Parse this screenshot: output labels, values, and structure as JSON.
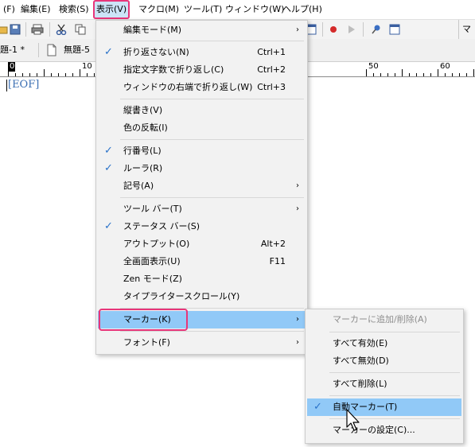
{
  "menubar": {
    "items": [
      {
        "label": "(F)"
      },
      {
        "label": "編集(E)"
      },
      {
        "label": "検索(S)"
      },
      {
        "label": "表示(V)"
      },
      {
        "label": "マクロ(M)"
      },
      {
        "label": "ツール(T)"
      },
      {
        "label": "ウィンドウ(W)"
      },
      {
        "label": "ヘルプ(H)"
      }
    ]
  },
  "toolbar": {
    "right_text": "マ",
    "icons": [
      "folder-icon",
      "save-icon",
      "print-icon",
      "cut-icon",
      "copy-icon",
      "window-icon",
      "record-icon",
      "play-icon",
      "pin-icon",
      "window-icon"
    ]
  },
  "tabs": [
    {
      "label": "題-1 *"
    },
    {
      "label": "無題-5"
    }
  ],
  "ruler": {
    "labels": [
      "0",
      "10",
      "50",
      "60"
    ]
  },
  "editor": {
    "eof": "[EOF]"
  },
  "view_menu": {
    "items": [
      {
        "label": "編集モード(M)",
        "shortcut": "",
        "arrow": "›",
        "check": ""
      },
      {
        "label": "折り返さない(N)",
        "shortcut": "Ctrl+1",
        "arrow": "",
        "check": "✓"
      },
      {
        "label": "指定文字数で折り返し(C)",
        "shortcut": "Ctrl+2",
        "arrow": "",
        "check": ""
      },
      {
        "label": "ウィンドウの右端で折り返し(W)",
        "shortcut": "Ctrl+3",
        "arrow": "",
        "check": ""
      },
      {
        "label": "縦書き(V)",
        "shortcut": "",
        "arrow": "",
        "check": ""
      },
      {
        "label": "色の反転(I)",
        "shortcut": "",
        "arrow": "",
        "check": ""
      },
      {
        "label": "行番号(L)",
        "shortcut": "",
        "arrow": "",
        "check": "✓"
      },
      {
        "label": "ルーラ(R)",
        "shortcut": "",
        "arrow": "",
        "check": "✓"
      },
      {
        "label": "記号(A)",
        "shortcut": "",
        "arrow": "›",
        "check": ""
      },
      {
        "label": "ツール バー(T)",
        "shortcut": "",
        "arrow": "›",
        "check": ""
      },
      {
        "label": "ステータス バー(S)",
        "shortcut": "",
        "arrow": "",
        "check": "✓"
      },
      {
        "label": "アウトプット(O)",
        "shortcut": "Alt+2",
        "arrow": "",
        "check": ""
      },
      {
        "label": "全画面表示(U)",
        "shortcut": "F11",
        "arrow": "",
        "check": ""
      },
      {
        "label": "Zen モード(Z)",
        "shortcut": "",
        "arrow": "",
        "check": ""
      },
      {
        "label": "タイプライタースクロール(Y)",
        "shortcut": "",
        "arrow": "",
        "check": ""
      },
      {
        "label": "マーカー(K)",
        "shortcut": "",
        "arrow": "›",
        "check": ""
      },
      {
        "label": "フォント(F)",
        "shortcut": "",
        "arrow": "›",
        "check": ""
      }
    ]
  },
  "marker_menu": {
    "items": [
      {
        "label": "マーカーに追加/削除(A)",
        "check": ""
      },
      {
        "label": "すべて有効(E)",
        "check": ""
      },
      {
        "label": "すべて無効(D)",
        "check": ""
      },
      {
        "label": "すべて削除(L)",
        "check": ""
      },
      {
        "label": "自動マーカー(T)",
        "check": "✓"
      },
      {
        "label": "マーカーの設定(C)...",
        "check": ""
      }
    ]
  },
  "colors": {
    "highlight_outline": "#e8367a",
    "hover": "#91c9f7",
    "check": "#2a72c9",
    "eof_text": "#3b6fb3"
  }
}
